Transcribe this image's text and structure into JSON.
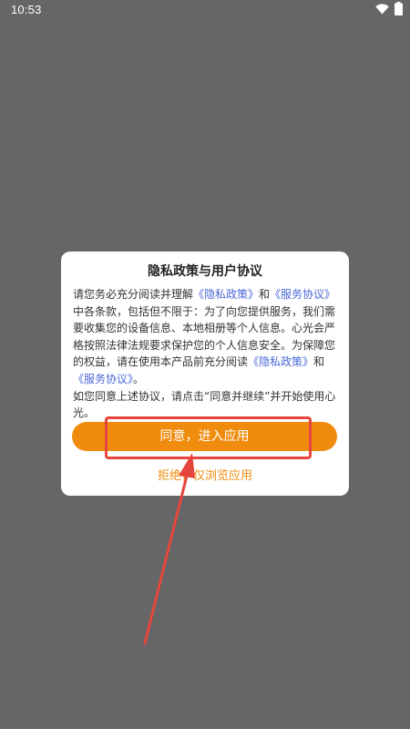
{
  "status_bar": {
    "time": "10:53"
  },
  "dialog": {
    "title": "隐私政策与用户协议",
    "body": {
      "part1": "请您务必充分阅读并理解",
      "privacy_link_1": "《隐私政策》",
      "and_1": "和",
      "service_link_1": "《服务协议》",
      "part2": "中各条款，包括但不限于：为了向您提供服务，我们需要收集您的设备信息、本地相册等个人信息。心光会严格按照法律法规要求保护您的个人信息安全。为保障您的权益，请在使用本产品前充分阅读",
      "privacy_link_2": "《隐私政策》",
      "and_2": "和",
      "service_link_2": "《服务协议》",
      "part3": "。",
      "part4": "如您同意上述协议，请点击“同意并继续”并开始使用心光。"
    },
    "agree_label": "同意，进入应用",
    "reject_label": "拒绝，仅浏览应用"
  },
  "colors": {
    "accent": "#ef8c0e",
    "link": "#4a67d6",
    "annotation": "#e5453c",
    "backdrop": "#666666"
  },
  "icons": [
    "wifi-icon",
    "battery-icon"
  ]
}
